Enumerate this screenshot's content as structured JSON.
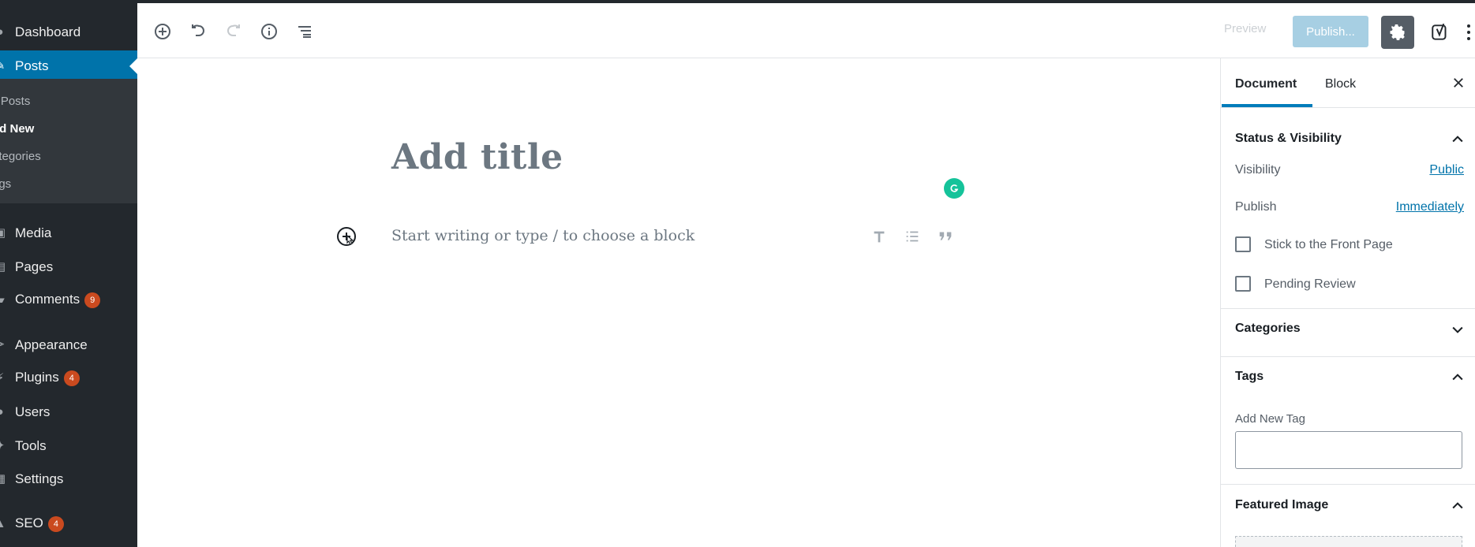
{
  "admin_menu": {
    "items": [
      {
        "label": "Dashboard",
        "icon": "dashboard-icon"
      },
      {
        "label": "Posts",
        "icon": "pin-icon",
        "active": true
      },
      {
        "label": "Media",
        "icon": "media-icon"
      },
      {
        "label": "Pages",
        "icon": "pages-icon"
      },
      {
        "label": "Comments",
        "icon": "comments-icon",
        "badge": "9"
      },
      {
        "label": "Appearance",
        "icon": "brush-icon"
      },
      {
        "label": "Plugins",
        "icon": "plugin-icon",
        "badge": "4"
      },
      {
        "label": "Users",
        "icon": "users-icon"
      },
      {
        "label": "Tools",
        "icon": "tools-icon"
      },
      {
        "label": "Settings",
        "icon": "settings-icon"
      },
      {
        "label": "SEO",
        "icon": "seo-icon",
        "badge": "4"
      }
    ],
    "submenu": [
      {
        "label": "ll Posts"
      },
      {
        "label": "dd New",
        "current": true
      },
      {
        "label": "ategories"
      },
      {
        "label": "ags"
      }
    ]
  },
  "toolbar": {
    "icons": [
      "add-block-icon",
      "undo-icon",
      "redo-icon",
      "info-icon",
      "outline-icon"
    ],
    "preview_label": "Preview",
    "publish_label": "Publish...",
    "settings_icon": "gear-icon",
    "yoast_icon": "yoast-icon",
    "more_icon": "more-vertical-icon"
  },
  "editor": {
    "title_placeholder": "Add title",
    "block_placeholder": "Start writing or type / to choose a block",
    "block_icons": [
      "heading-icon",
      "list-icon",
      "quote-icon"
    ],
    "grammarly_icon": "grammarly-icon",
    "inserter_icon": "plus-circle-icon"
  },
  "sidebar": {
    "tabs": [
      {
        "label": "Document",
        "active": true
      },
      {
        "label": "Block"
      }
    ],
    "close_icon": "close-icon",
    "status_visibility": {
      "title": "Status & Visibility",
      "visibility_label": "Visibility",
      "visibility_value": "Public",
      "publish_label": "Publish",
      "publish_value": "Immediately",
      "sticky_label": "Stick to the Front Page",
      "pending_label": "Pending Review"
    },
    "categories": {
      "title": "Categories"
    },
    "tags": {
      "title": "Tags",
      "add_label": "Add New Tag"
    },
    "featured_image": {
      "title": "Featured Image"
    }
  },
  "colors": {
    "admin_bg": "#23282d",
    "active_blue": "#0073aa",
    "badge": "#ca4a1f",
    "grammarly": "#15c39a"
  }
}
